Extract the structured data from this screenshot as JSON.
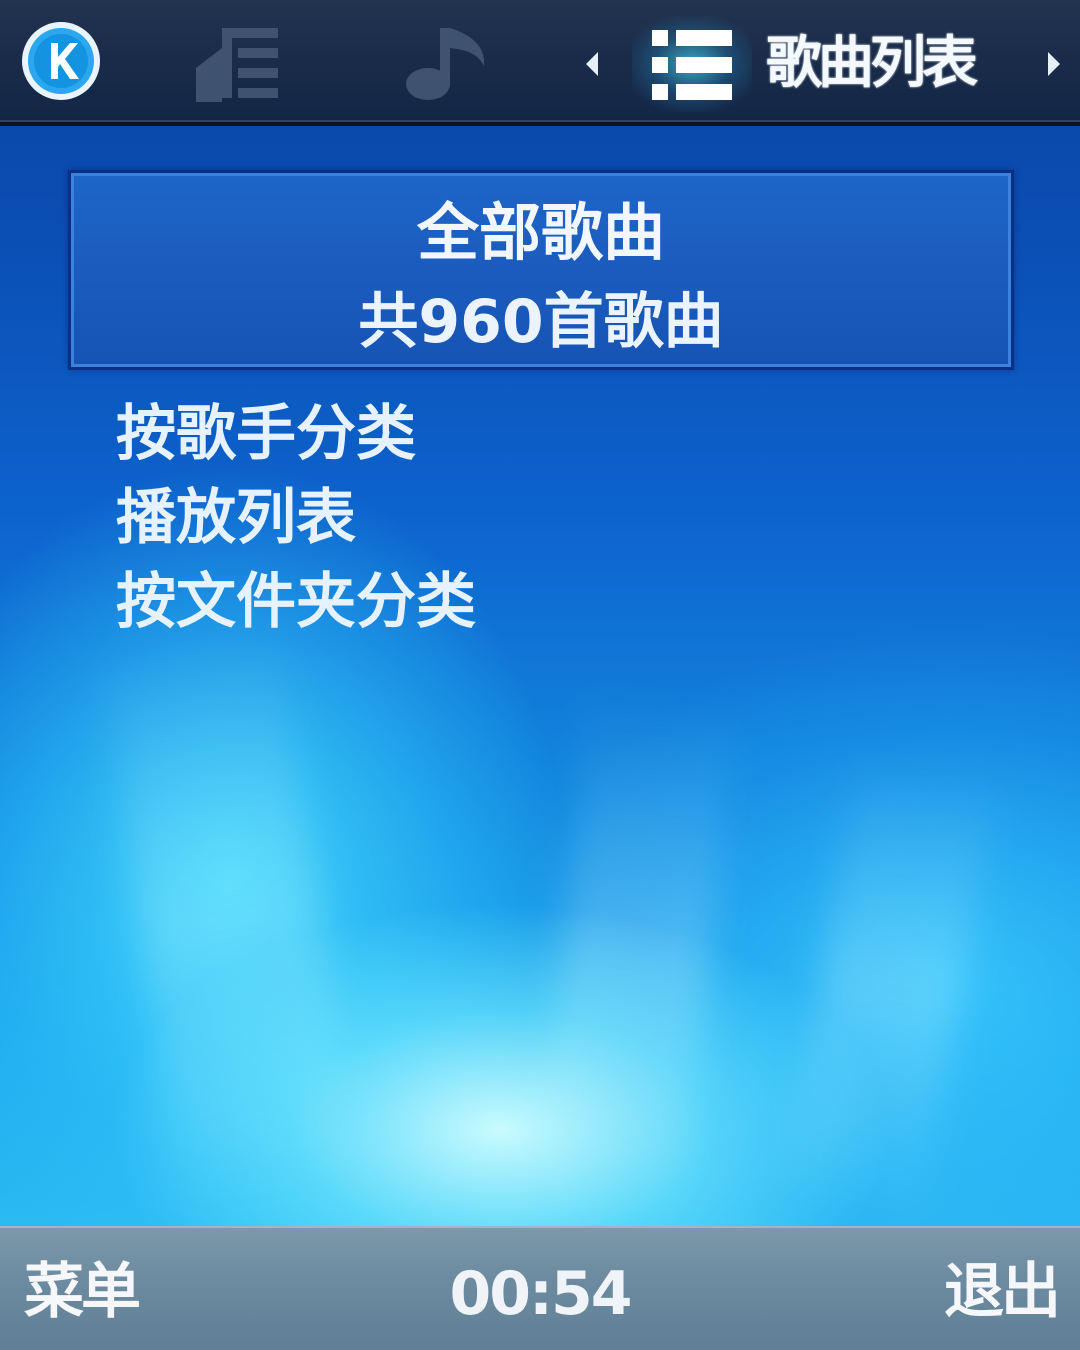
{
  "topbar": {
    "logo_icon": "k-logo-icon",
    "tabs": [
      {
        "icon": "artist-icon",
        "active": false
      },
      {
        "icon": "music-note-icon",
        "active": false
      },
      {
        "icon": "list-icon",
        "active": true
      }
    ],
    "title": "歌曲列表"
  },
  "selected_item": {
    "title": "全部歌曲",
    "subtitle": "共960首歌曲"
  },
  "menu": {
    "items": [
      {
        "label": "按歌手分类"
      },
      {
        "label": "播放列表"
      },
      {
        "label": "按文件夹分类"
      }
    ]
  },
  "softkeys": {
    "left": "菜单",
    "time": "00:54",
    "right": "退出"
  },
  "colors": {
    "topbar": "#1a2c4a",
    "highlight": "#1a5cbe",
    "accent_glow": "#50e6ff",
    "bottombar": "#6d8ba0"
  }
}
